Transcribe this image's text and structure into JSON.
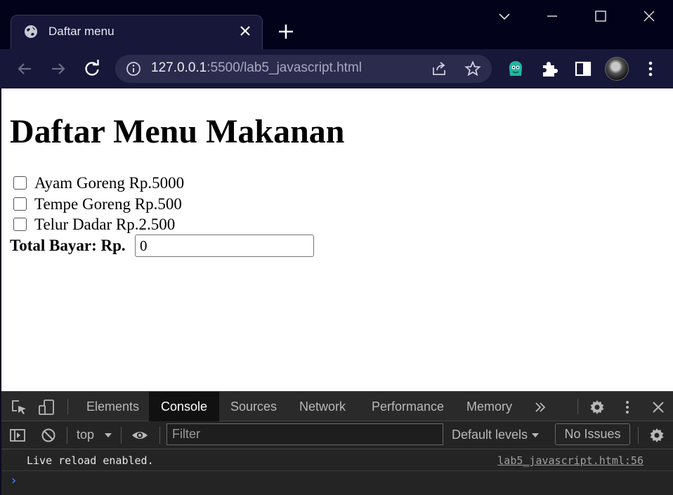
{
  "browser": {
    "tab": {
      "title": "Daftar menu"
    },
    "url": {
      "host": "127.0.0.1",
      "rest": ":5500/lab5_javascript.html"
    }
  },
  "page": {
    "heading": "Daftar Menu Makanan",
    "menu_items": [
      {
        "label": "Ayam Goreng Rp.5000",
        "checked": false
      },
      {
        "label": "Tempe Goreng Rp.500",
        "checked": false
      },
      {
        "label": "Telur Dadar Rp.2.500",
        "checked": false
      }
    ],
    "total_label": "Total Bayar: Rp.",
    "total_value": "0"
  },
  "devtools": {
    "tabs": [
      "Elements",
      "Console",
      "Sources",
      "Network",
      "Performance",
      "Memory"
    ],
    "active_tab": "Console",
    "context": "top",
    "filter_placeholder": "Filter",
    "levels": "Default levels",
    "issues": "No Issues",
    "console_message": "Live reload enabled.",
    "console_source": "lab5_javascript.html:56",
    "prompt_symbol": "›"
  },
  "colors": {
    "titlebar": "#02021a",
    "toolbar": "#17173a",
    "omnibox": "#2b2b4e",
    "devtools_bg": "#242424",
    "prompt_accent": "#4a8cff"
  }
}
